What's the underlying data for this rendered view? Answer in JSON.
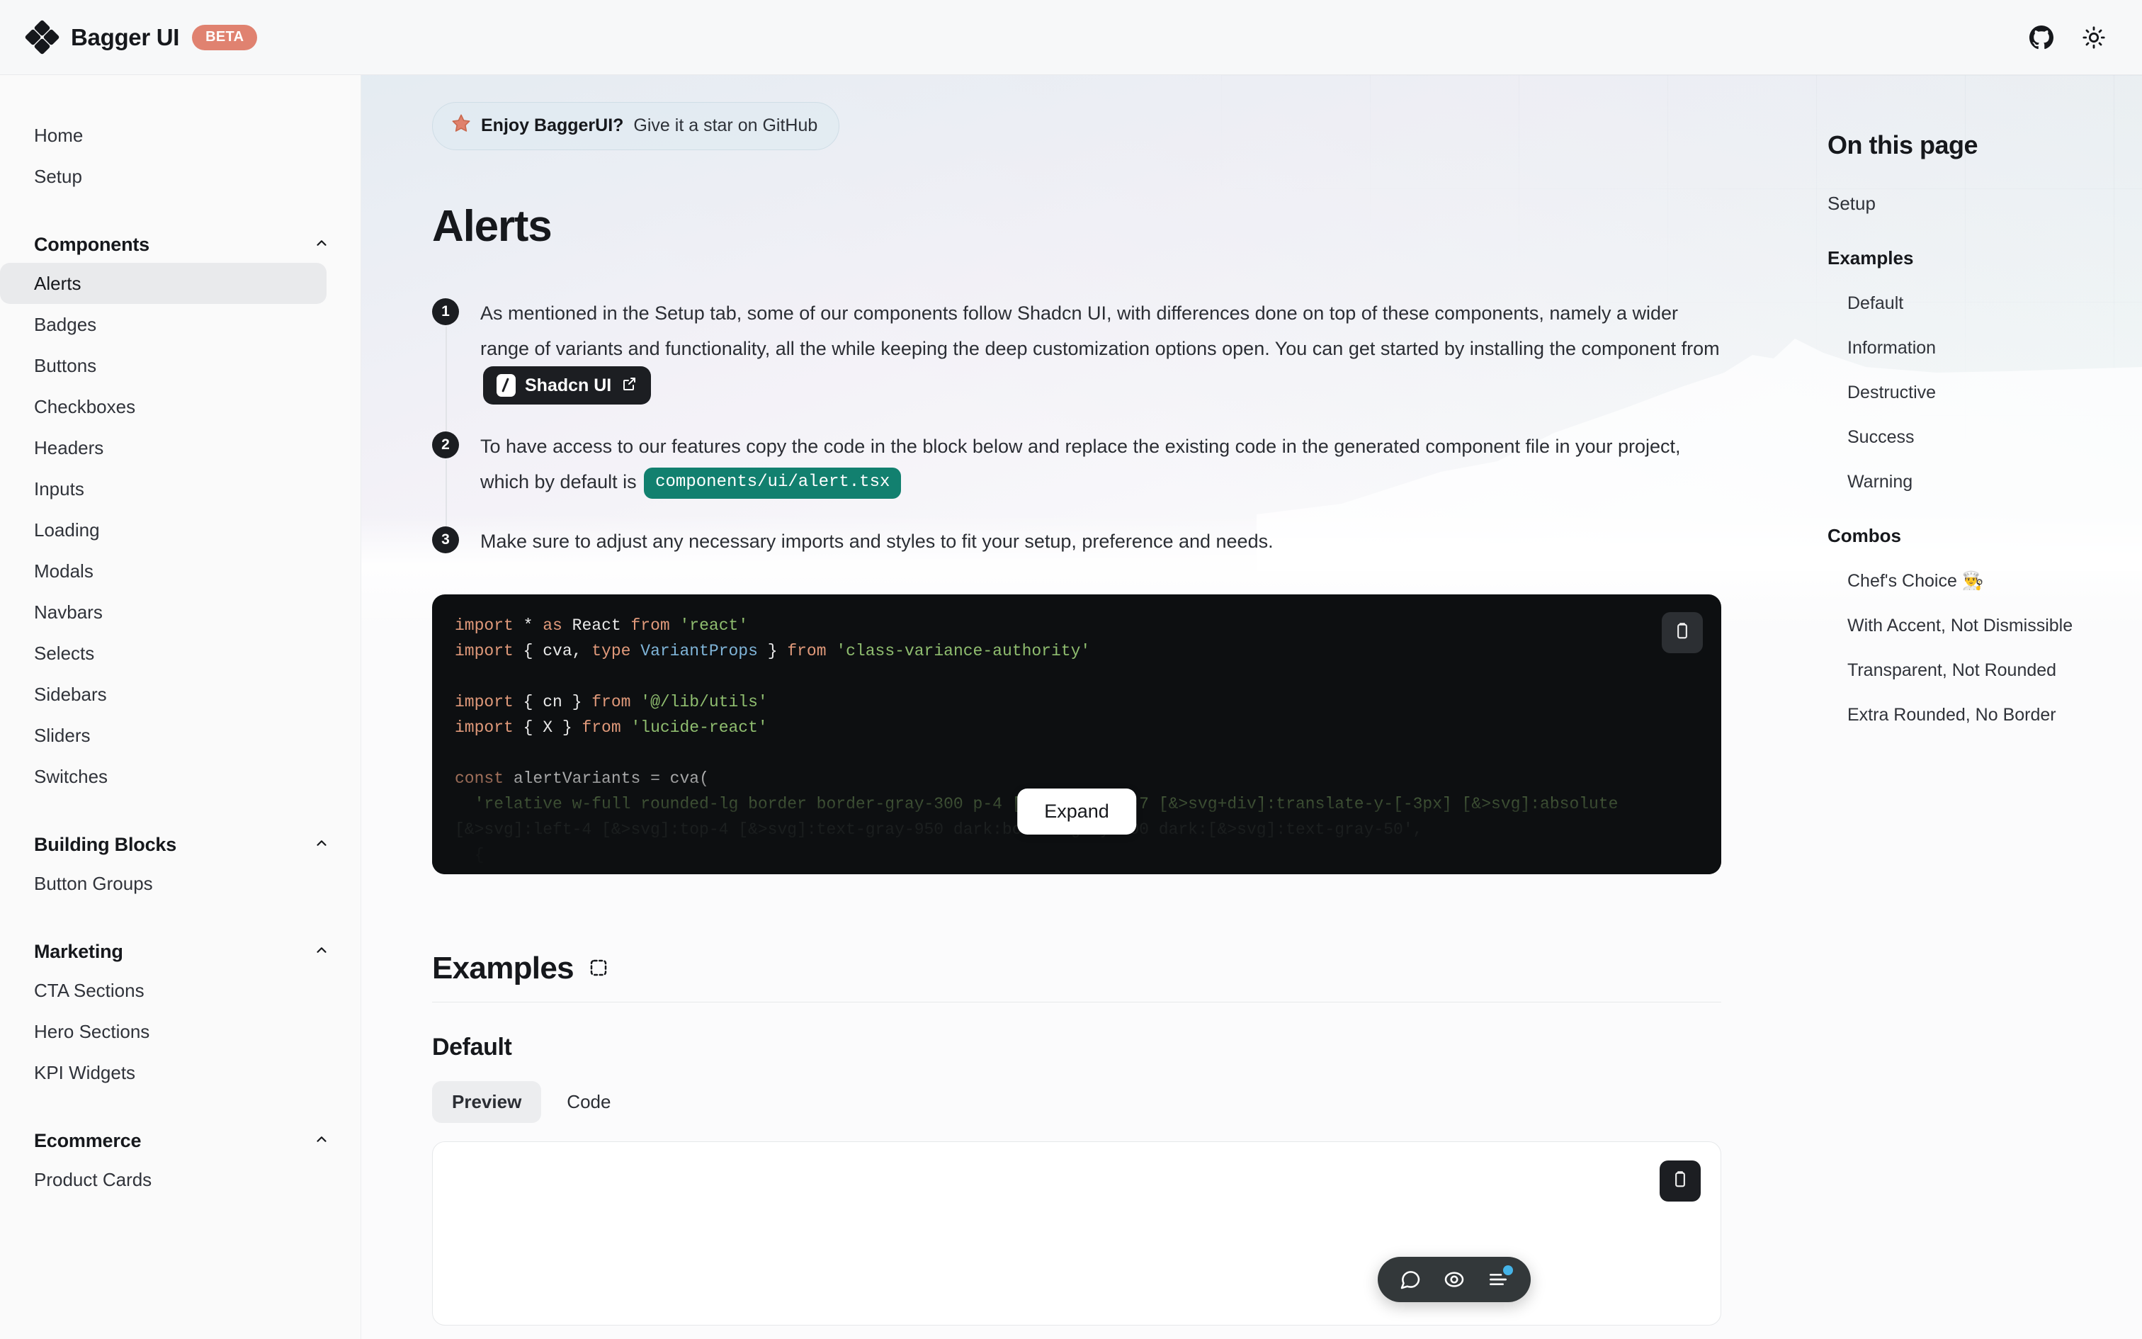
{
  "brand": {
    "name": "Bagger UI",
    "badge": "BETA",
    "logo_icon": "diamond-cluster-icon"
  },
  "topbar": {
    "github_icon": "github-icon",
    "theme_icon": "sun-icon"
  },
  "sidebar": {
    "top_links": [
      "Home",
      "Setup"
    ],
    "groups": [
      {
        "label": "Components",
        "items": [
          "Alerts",
          "Badges",
          "Buttons",
          "Checkboxes",
          "Headers",
          "Inputs",
          "Loading",
          "Modals",
          "Navbars",
          "Selects",
          "Sidebars",
          "Sliders",
          "Switches"
        ],
        "active": "Alerts"
      },
      {
        "label": "Building Blocks",
        "items": [
          "Button Groups"
        ]
      },
      {
        "label": "Marketing",
        "items": [
          "CTA Sections",
          "Hero Sections",
          "KPI Widgets"
        ]
      },
      {
        "label": "Ecommerce",
        "items": [
          "Product Cards"
        ]
      }
    ],
    "chevron_icon": "chevron-up-icon"
  },
  "banner": {
    "star_icon": "star-icon",
    "bold": "Enjoy BaggerUI?",
    "rest": "Give it a star on GitHub"
  },
  "page": {
    "title": "Alerts"
  },
  "steps": [
    {
      "num": "1",
      "text_a": "As mentioned in the Setup tab, some of our components follow Shadcn UI, with differences done on top of these components, namely a wider range of variants and functionality, all the while keeping the deep customization options open. You can get started by installing the component from",
      "chip": "Shadcn UI",
      "chip_icon": "external-link-icon",
      "text_b": ""
    },
    {
      "num": "2",
      "text_a": "To have access to our features copy the code in the block below and replace the existing code in the generated component file in your project, which by default is",
      "chip": "components/ui/alert.tsx",
      "text_b": ""
    },
    {
      "num": "3",
      "text_a": "Make sure to adjust any necessary imports and styles to fit your setup, preference and needs.",
      "chip": "",
      "text_b": ""
    }
  ],
  "code": {
    "copy_icon": "clipboard-icon",
    "expand_label": "Expand",
    "lines": [
      [
        {
          "t": "import ",
          "c": "kw"
        },
        {
          "t": "* ",
          "c": "id"
        },
        {
          "t": "as ",
          "c": "kw"
        },
        {
          "t": "React ",
          "c": "id"
        },
        {
          "t": "from ",
          "c": "kw"
        },
        {
          "t": "'react'",
          "c": "str"
        }
      ],
      [
        {
          "t": "import ",
          "c": "kw"
        },
        {
          "t": "{ cva, ",
          "c": "id"
        },
        {
          "t": "type ",
          "c": "kw"
        },
        {
          "t": "VariantProps ",
          "c": "typ"
        },
        {
          "t": "} ",
          "c": "id"
        },
        {
          "t": "from ",
          "c": "kw"
        },
        {
          "t": "'class-variance-authority'",
          "c": "str"
        }
      ],
      [
        {
          "t": "",
          "c": "id"
        }
      ],
      [
        {
          "t": "import ",
          "c": "kw"
        },
        {
          "t": "{ cn } ",
          "c": "id"
        },
        {
          "t": "from ",
          "c": "kw"
        },
        {
          "t": "'@/lib/utils'",
          "c": "str"
        }
      ],
      [
        {
          "t": "import ",
          "c": "kw"
        },
        {
          "t": "{ X } ",
          "c": "id"
        },
        {
          "t": "from ",
          "c": "kw"
        },
        {
          "t": "'lucide-react'",
          "c": "str"
        }
      ],
      [
        {
          "t": "",
          "c": "id"
        }
      ],
      [
        {
          "t": "const ",
          "c": "kw"
        },
        {
          "t": "alertVariants ",
          "c": "id"
        },
        {
          "t": "= ",
          "c": "id"
        },
        {
          "t": "cva(",
          "c": "id"
        }
      ],
      [
        {
          "t": "  'relative w-full rounded-lg border border-gray-300 p-4 [&>svg~*]:pl-7 [&>svg+div]:translate-y-[-3px] [&>svg]:absolute",
          "c": "str"
        }
      ],
      [
        {
          "t": "[&>svg]:left-4 [&>svg]:top-4 [&>svg]:text-gray-950 dark:border-gray-800 dark:[&>svg]:text-gray-50',",
          "c": "dim"
        }
      ],
      [
        {
          "t": "  {",
          "c": "dim"
        }
      ]
    ]
  },
  "examples": {
    "heading": "Examples",
    "heading_icon": "dashed-square-icon",
    "subheading": "Default",
    "tabs": [
      {
        "label": "Preview",
        "active": true
      },
      {
        "label": "Code",
        "active": false
      }
    ],
    "preview_copy_icon": "clipboard-icon"
  },
  "float_toolbar": {
    "items": [
      {
        "icon": "comment-icon",
        "badge": false
      },
      {
        "icon": "target-eye-icon",
        "badge": false
      },
      {
        "icon": "list-lines-icon",
        "badge": true
      }
    ]
  },
  "toc": {
    "title": "On this page",
    "entries": [
      {
        "label": "Setup",
        "level": 1,
        "bold": false
      },
      {
        "label": "Examples",
        "level": 1,
        "bold": true
      },
      {
        "label": "Default",
        "level": 2,
        "bold": false
      },
      {
        "label": "Information",
        "level": 2,
        "bold": false
      },
      {
        "label": "Destructive",
        "level": 2,
        "bold": false
      },
      {
        "label": "Success",
        "level": 2,
        "bold": false
      },
      {
        "label": "Warning",
        "level": 2,
        "bold": false
      },
      {
        "label": "Combos",
        "level": 1,
        "bold": true
      },
      {
        "label": "Chef's Choice 👨‍🍳",
        "level": 2,
        "bold": false
      },
      {
        "label": "With Accent, Not Dismissible",
        "level": 2,
        "bold": false
      },
      {
        "label": "Transparent, Not Rounded",
        "level": 2,
        "bold": false
      },
      {
        "label": "Extra Rounded, No Border",
        "level": 2,
        "bold": false
      }
    ]
  },
  "colors": {
    "accent_beta": "#e08270",
    "code_bg": "#0d0f11",
    "chip_green": "#12806f",
    "badge_blue": "#45b4e8"
  }
}
